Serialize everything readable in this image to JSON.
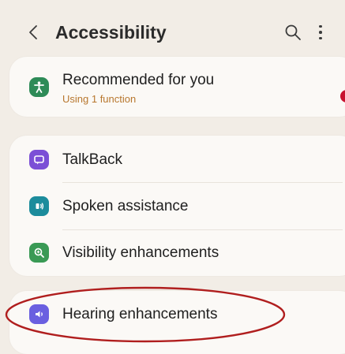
{
  "header": {
    "title": "Accessibility"
  },
  "recommended": {
    "label": "Recommended for you",
    "subtitle": "Using 1 function"
  },
  "items": [
    {
      "label": "TalkBack"
    },
    {
      "label": "Spoken assistance"
    },
    {
      "label": "Visibility enhancements"
    },
    {
      "label": "Hearing enhancements"
    }
  ],
  "colors": {
    "background": "#f2ede6",
    "card": "#fbf9f6",
    "recommended_icon": "#2e8b57",
    "talkback_icon": "#7b4fd6",
    "spoken_icon": "#1c8c9c",
    "visibility_icon": "#3a9a55",
    "hearing_icon": "#6a5fe0",
    "subtitle": "#b8772e",
    "annotation_circle": "#b01e1e"
  },
  "icons": {
    "back": "chevron-left-icon",
    "search": "search-icon",
    "more": "more-vertical-icon",
    "recommended": "accessibility-person-icon",
    "talkback": "talkback-icon",
    "spoken": "spoken-assistance-icon",
    "visibility": "visibility-magnifier-icon",
    "hearing": "hearing-icon"
  }
}
